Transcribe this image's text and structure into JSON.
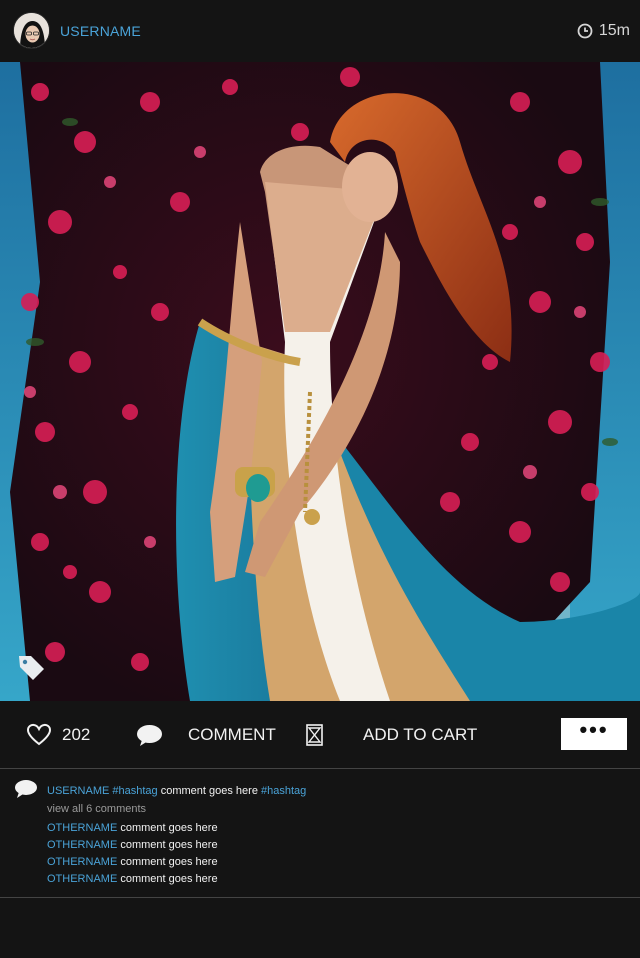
{
  "header": {
    "username": "USERNAME",
    "time": "15m"
  },
  "actions": {
    "likes": "202",
    "comment_label": "COMMENT",
    "cart_label": "ADD TO CART",
    "more_label": "•••"
  },
  "caption": {
    "username": "USERNAME",
    "hashtag1": "#hashtag",
    "text": "comment goes here",
    "hashtag2": "#hashtag"
  },
  "view_all": "view all 6 comments",
  "comments": [
    {
      "name": "OTHERNAME",
      "text": "comment goes here"
    },
    {
      "name": "OTHERNAME",
      "text": "comment goes here"
    },
    {
      "name": "OTHERNAME",
      "text": "comment goes here"
    },
    {
      "name": "OTHERNAME",
      "text": "comment goes here"
    }
  ],
  "colors": {
    "accent": "#4aa3d8",
    "background": "#141414",
    "text": "#f2f2f2",
    "muted": "#9a9a9a"
  },
  "icons": [
    "heart-icon",
    "comment-bubble-icon",
    "cart-hourglass-icon",
    "clock-icon",
    "tag-icon"
  ]
}
